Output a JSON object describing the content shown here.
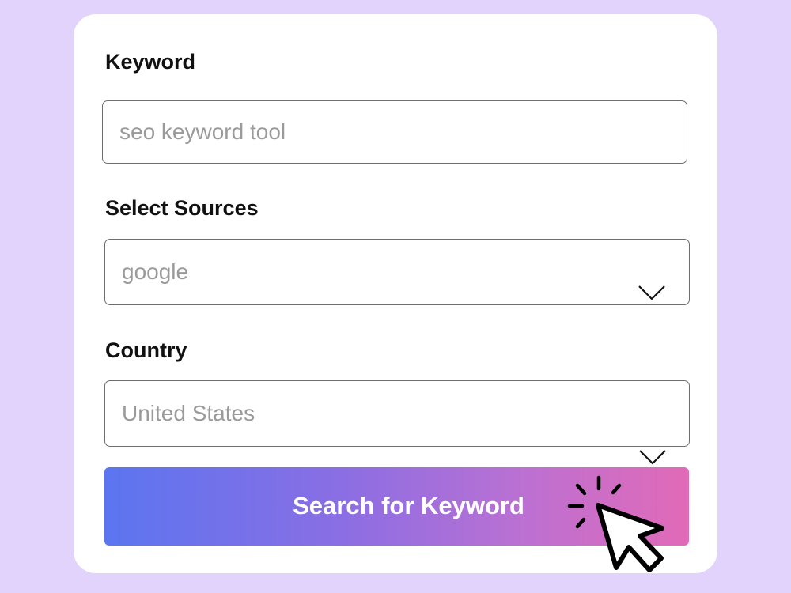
{
  "form": {
    "keyword": {
      "label": "Keyword",
      "placeholder": "seo keyword tool"
    },
    "sources": {
      "label": "Select Sources",
      "selected": "google"
    },
    "country": {
      "label": "Country",
      "selected": "United States"
    },
    "submit_label": "Search for Keyword"
  },
  "colors": {
    "background": "#e2d3fd",
    "card": "#ffffff",
    "button_gradient_start": "#5b75f0",
    "button_gradient_end": "#e26ab7"
  },
  "icons": {
    "sources_dropdown": "chevron-down-icon",
    "country_dropdown": "chevron-down-icon",
    "cursor": "click-cursor-icon"
  }
}
